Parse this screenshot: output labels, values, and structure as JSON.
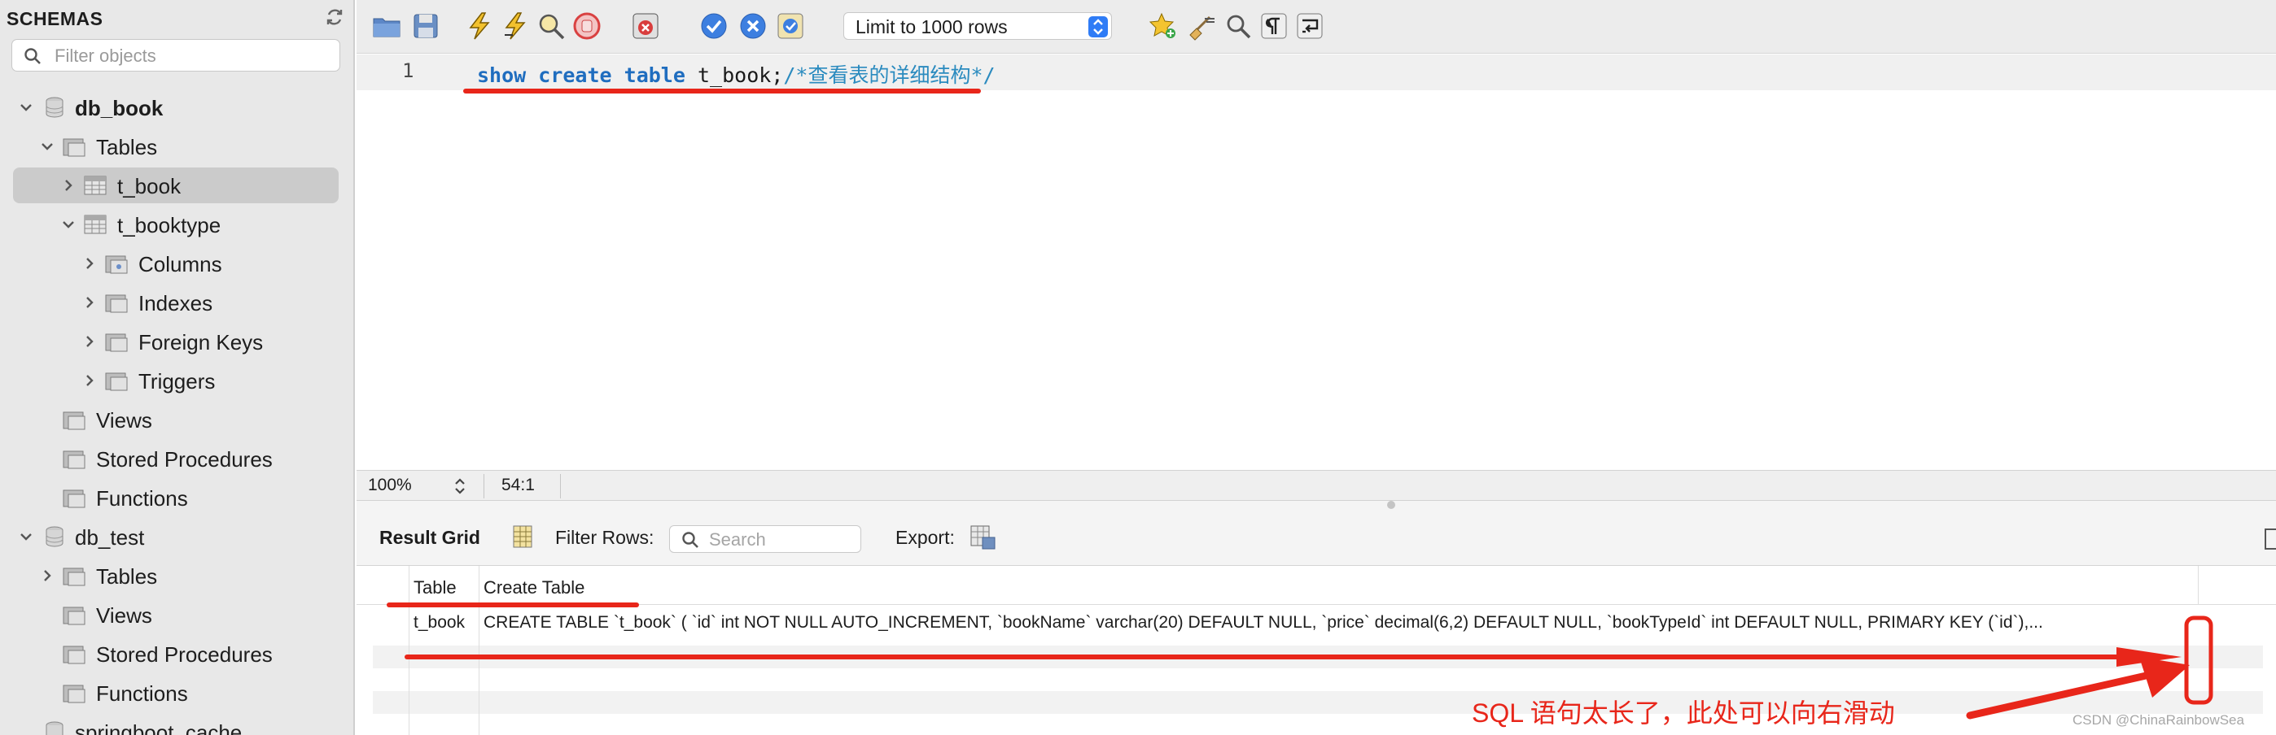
{
  "sidebar": {
    "title": "SCHEMAS",
    "filter_placeholder": "Filter objects",
    "tree": {
      "db_book": "db_book",
      "tables": "Tables",
      "t_book": "t_book",
      "t_booktype": "t_booktype",
      "columns": "Columns",
      "indexes": "Indexes",
      "foreign_keys": "Foreign Keys",
      "triggers": "Triggers",
      "views": "Views",
      "stored_procedures": "Stored Procedures",
      "functions": "Functions",
      "db_test": "db_test",
      "tables2": "Tables",
      "views2": "Views",
      "stored_procedures2": "Stored Procedures",
      "functions2": "Functions",
      "springboot_cache": "springboot_cache"
    }
  },
  "toolbar": {
    "limit_value": "Limit to 1000 rows"
  },
  "editor": {
    "line_number": "1",
    "kw_show": "show",
    "kw_create": "create",
    "kw_table": "table",
    "identifier": "t_book;",
    "comment": "/*查看表的详细结构*/"
  },
  "statusbar": {
    "zoom": "100%",
    "cursor": "54:1"
  },
  "result": {
    "result_grid_label": "Result Grid",
    "filter_rows_label": "Filter Rows:",
    "search_placeholder": "Search",
    "export_label": "Export:",
    "columns": [
      "Table",
      "Create Table"
    ],
    "rows": [
      [
        "t_book",
        "CREATE TABLE `t_book` (   `id` int NOT NULL AUTO_INCREMENT,   `bookName` varchar(20) DEFAULT NULL,   `price` decimal(6,2) DEFAULT NULL,   `bookTypeId` int DEFAULT NULL,   PRIMARY KEY (`id`),..."
      ]
    ]
  },
  "annotation": {
    "note": "SQL 语句太长了，此处可以向右滑动",
    "color": "#e8261a"
  },
  "watermark": "CSDN @ChinaRainbowSea"
}
